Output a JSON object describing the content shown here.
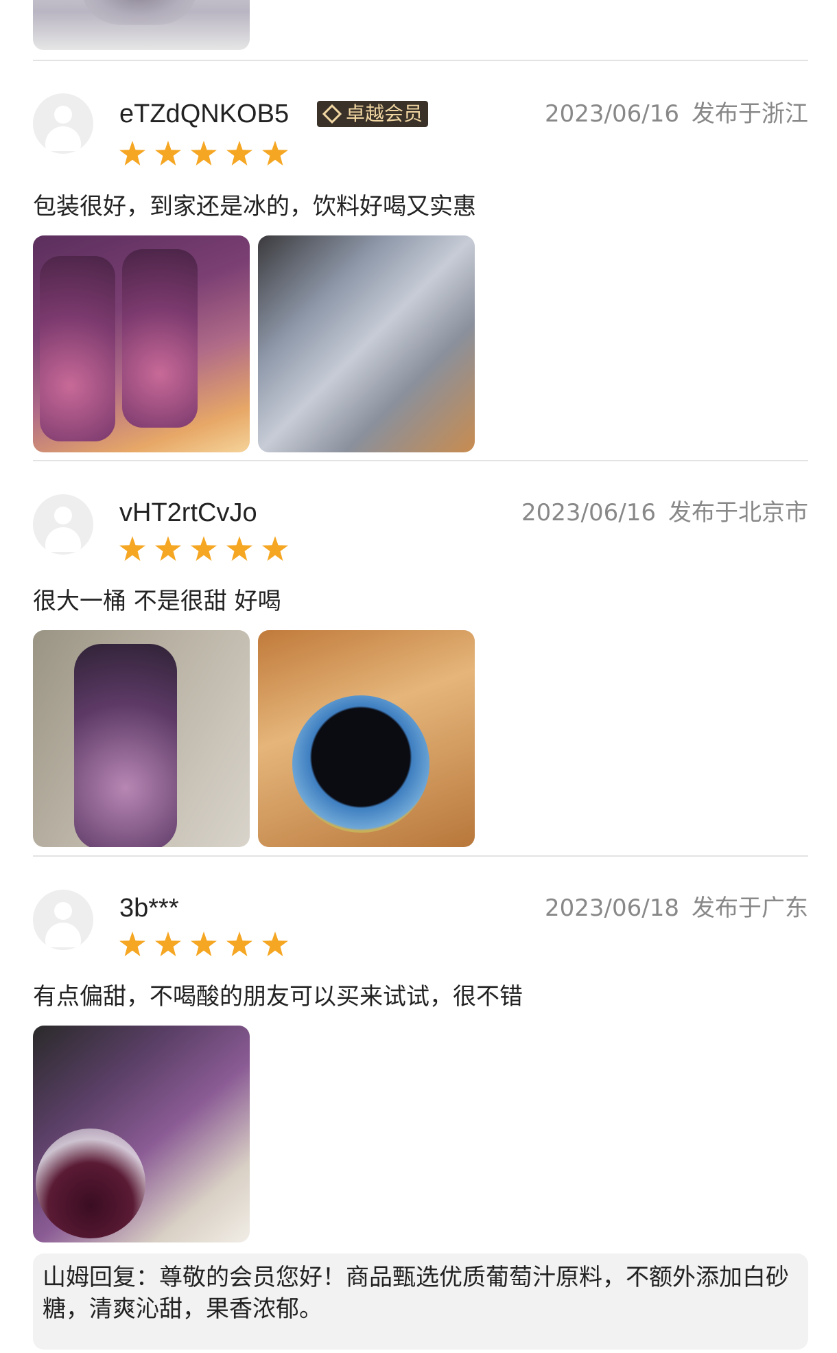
{
  "reviews": [
    {
      "username": "eTZdQNKOB5",
      "badge": "卓越会员",
      "date": "2023/06/16",
      "location": "发布于浙江",
      "rating": 5,
      "comment": "包装很好，到家还是冰的，饮料好喝又实惠"
    },
    {
      "username": "vHT2rtCvJo",
      "date": "2023/06/16",
      "location": "发布于北京市",
      "rating": 5,
      "comment": "很大一桶 不是很甜 好喝"
    },
    {
      "username": "3b***",
      "date": "2023/06/18",
      "location": "发布于广东",
      "rating": 5,
      "comment": "有点偏甜，不喝酸的朋友可以买来试试，很不错"
    }
  ],
  "reply": {
    "text": "山姆回复：尊敬的会员您好！商品甄选优质葡萄汁原料，不额外添加白砂糖，清爽沁甜，果香浓郁。"
  },
  "colors": {
    "star": "#f5a623",
    "badge_bg": "#3a3228",
    "badge_text": "#f2d7a3",
    "meta_text": "#888888"
  }
}
